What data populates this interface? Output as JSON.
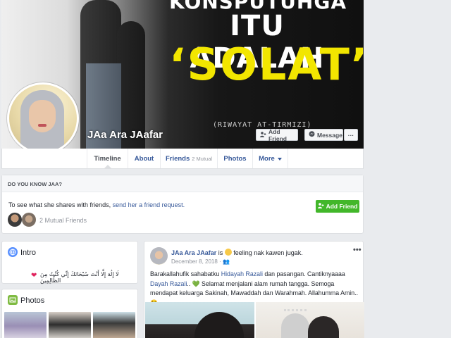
{
  "cover": {
    "line1": "KONSPUTUHGA",
    "line2": "ITU ADALAH",
    "line3": "‘SOLAT’",
    "source": "(RIWAYAT AT-TIRMIZI)"
  },
  "profile": {
    "name": "JAa Ara JAafar",
    "add_friend": "Add Friend",
    "message": "Message",
    "more": "···"
  },
  "tabs": [
    {
      "label": "Timeline"
    },
    {
      "label": "About"
    },
    {
      "label": "Friends",
      "sub": "2 Mutual"
    },
    {
      "label": "Photos"
    },
    {
      "label": "More"
    }
  ],
  "know": {
    "heading": "DO YOU KNOW JAA?",
    "text": "To see what she shares with friends, ",
    "link": "send her a friend request.",
    "button": "Add Friend",
    "mutual": "2 Mutual Friends"
  },
  "intro": {
    "title": "Intro",
    "text": "لَا إِلَٰهَ إِلَّا أَنْتَ سُبْحَانَكَ إِنِّي كُنْتُ مِنَ الظَّالِمِينَ"
  },
  "photos": {
    "title": "Photos"
  },
  "post": {
    "author": "JAa Ara JAafar",
    "is": " is ",
    "feeling": " feeling nak kawen jugak.",
    "date": "December 8, 2018 · ",
    "menu": "•••",
    "body_1": "Barakallahufik sahabatku ",
    "link_1": "Hidayah Razali",
    "body_2": " dan pasangan. Cantiknyaaaa ",
    "link_2": "Dayah Razali",
    "body_3": ".. 💚 Selamat menjalani alam rumah tangga. Semoga mendapat keluarga Sakinah, Mawaddah dan Warahmah. Allahumma Amin.. 😘"
  },
  "colors": {
    "link": "#365899",
    "green_button": "#42b72a",
    "cover_yellow": "#f2e600"
  }
}
